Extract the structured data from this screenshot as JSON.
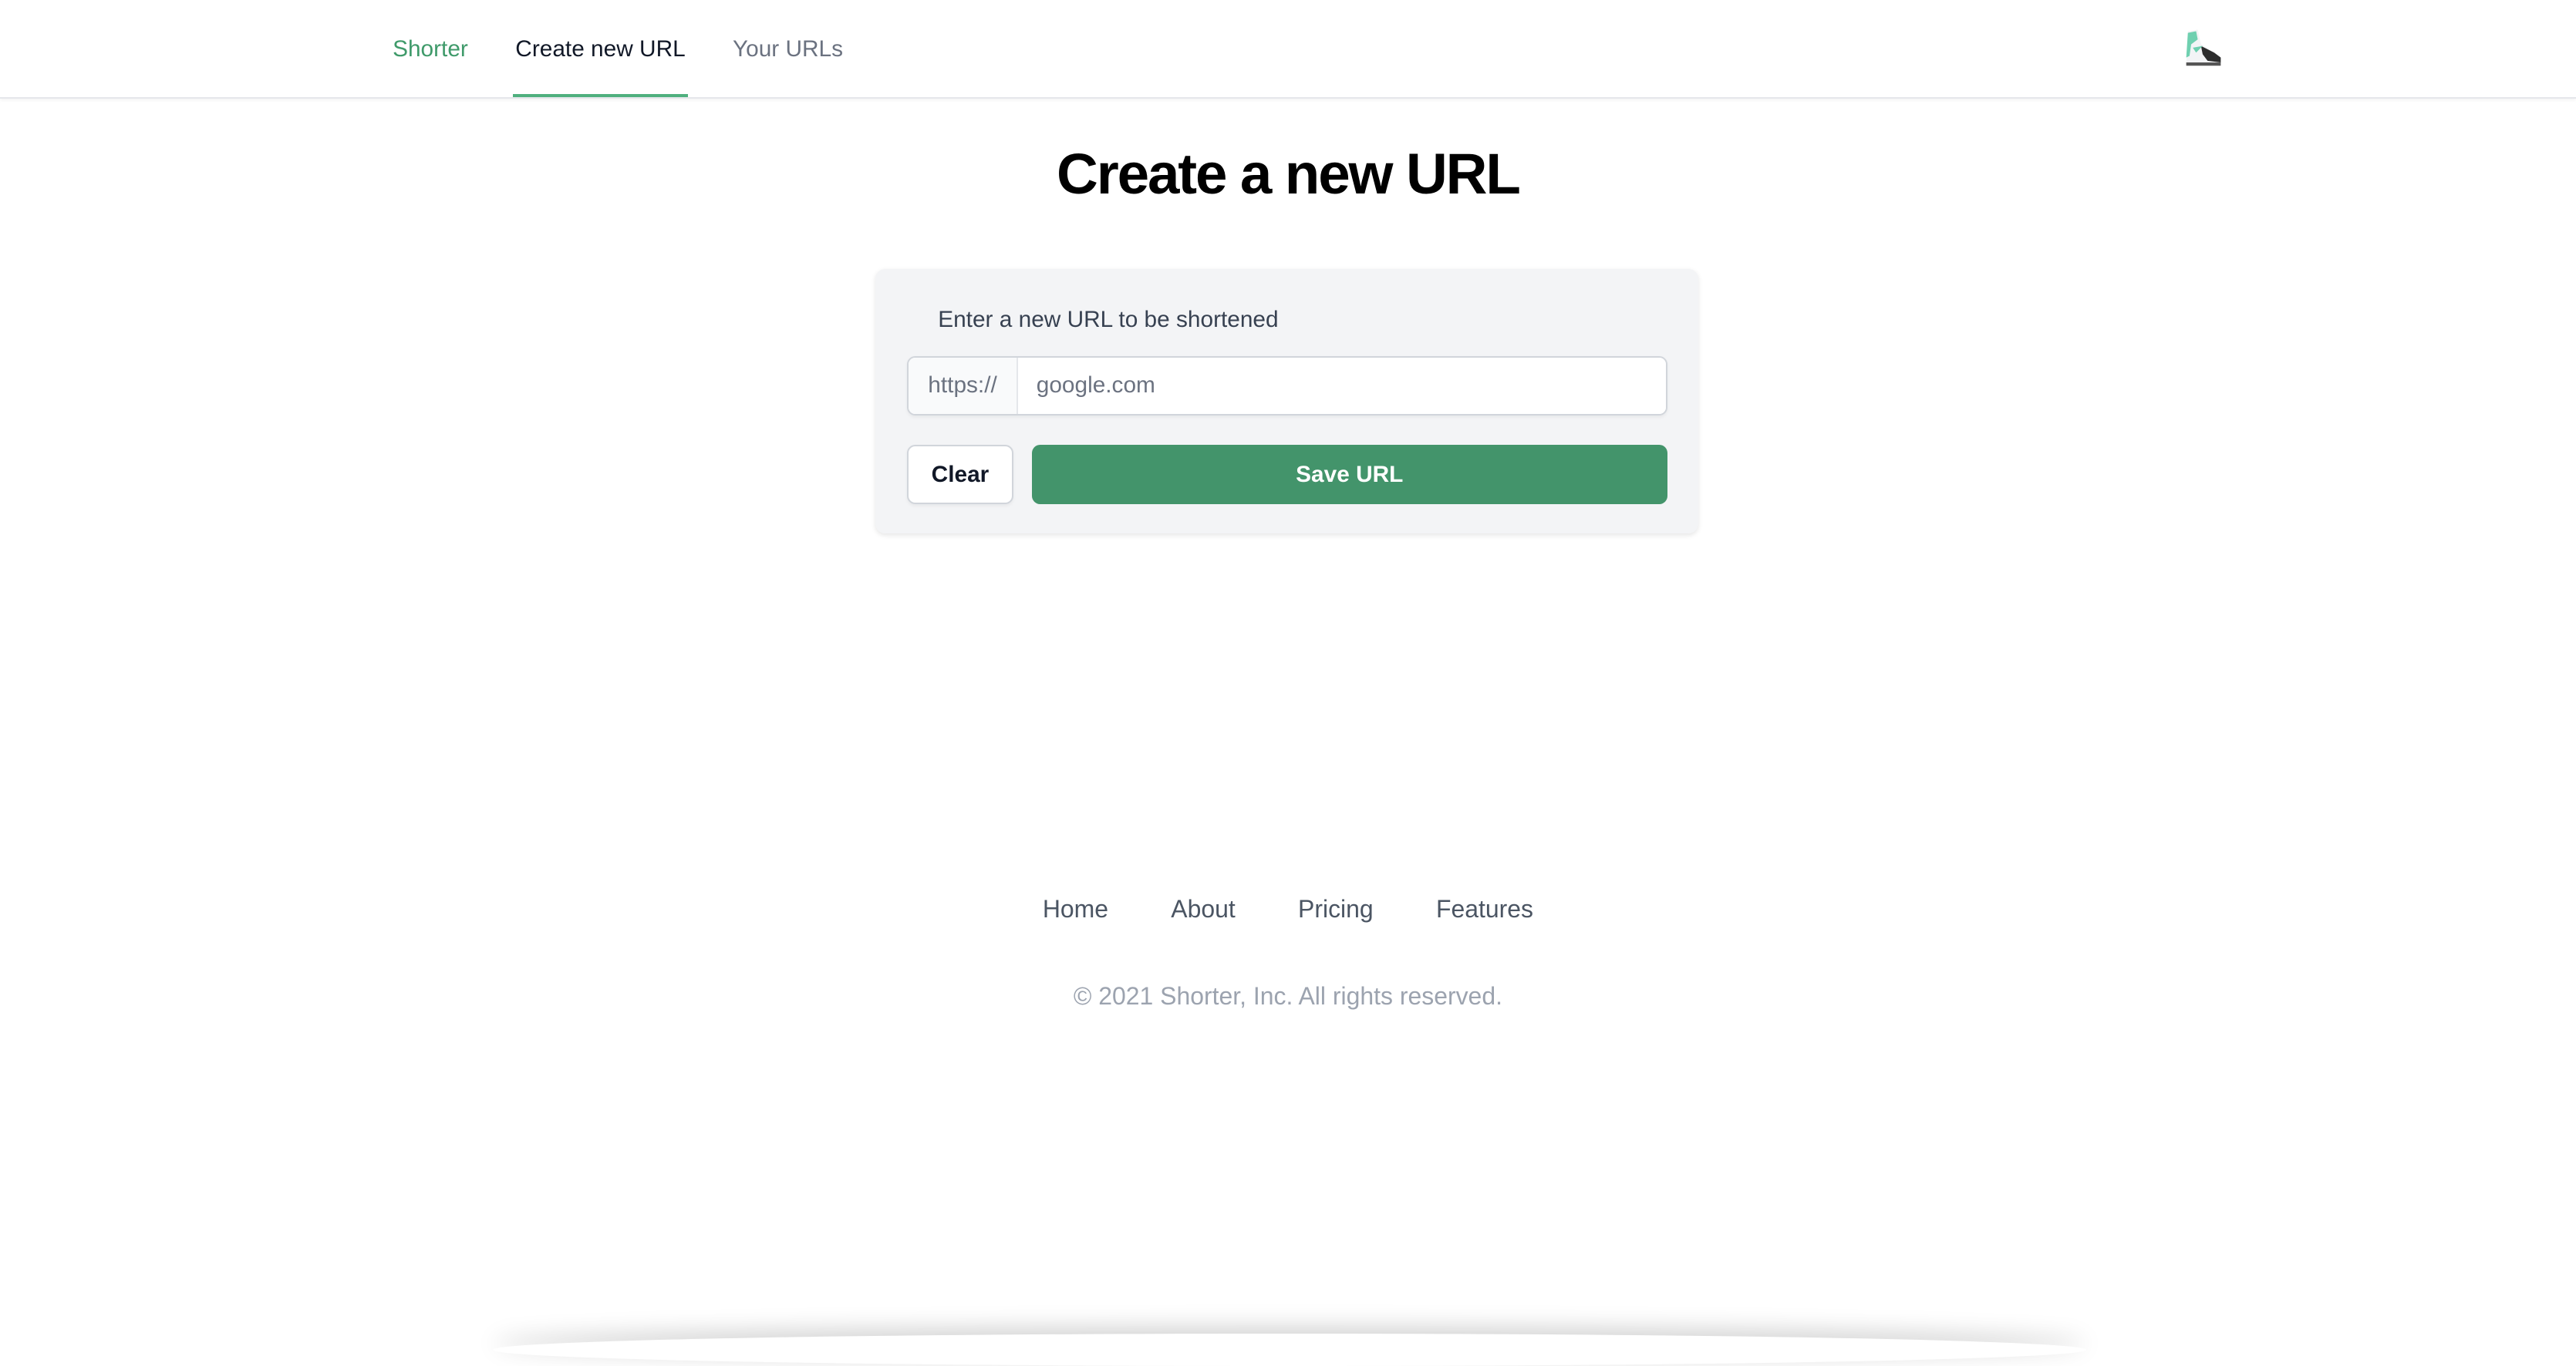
{
  "nav": {
    "brand": "Shorter",
    "tabs": [
      {
        "label": "Create new URL",
        "active": true
      },
      {
        "label": "Your URLs",
        "active": false
      }
    ],
    "avatar_icon": "sneaker-emoji"
  },
  "page": {
    "title": "Create a new URL"
  },
  "form": {
    "label": "Enter a new URL to be shortened",
    "prefix": "https://",
    "url_placeholder": "google.com",
    "clear_label": "Clear",
    "save_label": "Save URL"
  },
  "footer": {
    "links": [
      "Home",
      "About",
      "Pricing",
      "Features"
    ],
    "copyright": "© 2021 Shorter, Inc. All rights reserved."
  },
  "colors": {
    "accent": "#43946b",
    "brand": "#3f9a6a",
    "tab_underline": "#4fb07e"
  }
}
